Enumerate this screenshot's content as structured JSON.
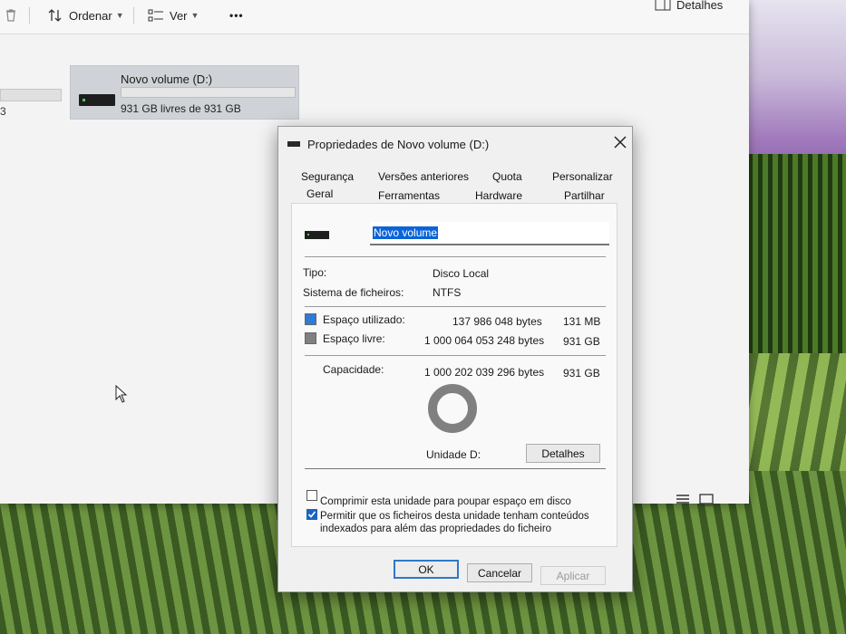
{
  "explorer": {
    "toolbar": {
      "sort_label": "Ordenar",
      "view_label": "Ver",
      "more_label": "•••",
      "details_label": "Detalhes"
    },
    "left_drive_caption": "3",
    "drive": {
      "name": "Novo volume (D:)",
      "space_text": "931 GB livres de 931 GB",
      "used_fraction": 0.0001
    }
  },
  "dialog": {
    "title": "Propriedades de Novo volume (D:)",
    "tabs_row1": [
      "Segurança",
      "Versões anteriores",
      "Quota",
      "Personalizar"
    ],
    "tabs_row2": [
      "Geral",
      "Ferramentas",
      "Hardware",
      "Partilhar"
    ],
    "active_tab": "Geral",
    "volume_name": "Novo volume",
    "type_label": "Tipo:",
    "type_value": "Disco Local",
    "fs_label": "Sistema de ficheiros:",
    "fs_value": "NTFS",
    "used_label": "Espaço utilizado:",
    "used_bytes": "137 986 048 bytes",
    "used_size": "131 MB",
    "free_label": "Espaço livre:",
    "free_bytes": "1 000 064 053 248 bytes",
    "free_size": "931 GB",
    "capacity_label": "Capacidade:",
    "capacity_bytes": "1 000 202 039 296 bytes",
    "capacity_size": "931 GB",
    "drive_label": "Unidade D:",
    "details_button": "Detalhes",
    "compress_label": "Comprimir esta unidade para poupar espaço em disco",
    "compress_checked": false,
    "index_label_line1": "Permitir que os ficheiros desta unidade tenham conteúdos",
    "index_label_line2": "indexados para além das propriedades do ficheiro",
    "index_checked": true,
    "ok_button": "OK",
    "cancel_button": "Cancelar",
    "apply_button": "Aplicar",
    "colors": {
      "used": "#2f7bd6",
      "free": "#808080"
    }
  }
}
